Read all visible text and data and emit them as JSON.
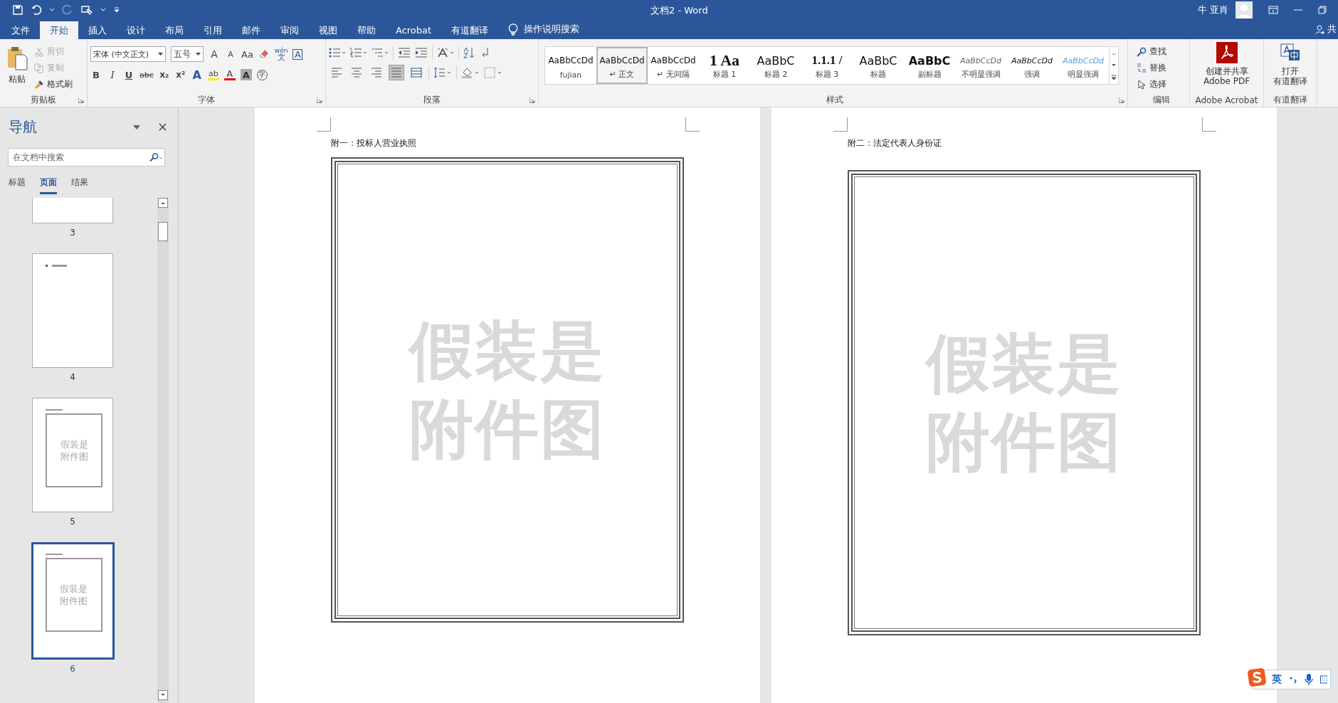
{
  "title_bar": {
    "title": "文档2 - Word",
    "user": "牛 亚肖"
  },
  "ribbon_tabs": [
    {
      "label": "文件",
      "selected": false
    },
    {
      "label": "开始",
      "selected": true
    },
    {
      "label": "插入",
      "selected": false
    },
    {
      "label": "设计",
      "selected": false
    },
    {
      "label": "布局",
      "selected": false
    },
    {
      "label": "引用",
      "selected": false
    },
    {
      "label": "邮件",
      "selected": false
    },
    {
      "label": "审阅",
      "selected": false
    },
    {
      "label": "视图",
      "selected": false
    },
    {
      "label": "帮助",
      "selected": false
    },
    {
      "label": "Acrobat",
      "selected": false
    },
    {
      "label": "有道翻译",
      "selected": false
    }
  ],
  "tell_me": "操作说明搜索",
  "share": "共",
  "clipboard": {
    "paste": "粘贴",
    "label": "剪贴板",
    "actions": [
      {
        "label": "剪切",
        "kind": "cut",
        "disabled": true
      },
      {
        "label": "复制",
        "kind": "copy",
        "disabled": true
      },
      {
        "label": "格式刷",
        "kind": "brush",
        "disabled": false
      }
    ]
  },
  "font": {
    "label": "字体",
    "font_name": "宋体 (中文正文)",
    "font_size": "五号",
    "row1": [
      {
        "glyph": "A",
        "kind": "grow"
      },
      {
        "glyph": "A",
        "kind": "shrink"
      },
      {
        "glyph": "Aa",
        "kind": "case"
      }
    ],
    "row2": [
      {
        "glyph": "B",
        "kind": "bold"
      },
      {
        "glyph": "I",
        "kind": "italic"
      },
      {
        "glyph": "U",
        "kind": "underline"
      },
      {
        "glyph": "abc",
        "kind": "strike"
      },
      {
        "glyph": "x₂",
        "kind": "sub"
      },
      {
        "glyph": "x²",
        "kind": "sup"
      }
    ],
    "phonetic": "wén",
    "phonetic_char": "文",
    "border_char": "A",
    "effects_char": "A",
    "highlight_char": "ab",
    "color_char": "A",
    "shade_char": "A",
    "enclose_char": "字"
  },
  "paragraph": {
    "label": "段落",
    "alignments": [
      {
        "kind": "left",
        "selected": false
      },
      {
        "kind": "center",
        "selected": false
      },
      {
        "kind": "right",
        "selected": false
      },
      {
        "kind": "justify",
        "selected": true
      },
      {
        "kind": "distributed",
        "selected": false
      }
    ]
  },
  "styles": {
    "label": "样式",
    "items": [
      {
        "preview": "AaBbCcDd",
        "name": "fujian",
        "kind": "plain",
        "selected": false
      },
      {
        "preview": "AaBbCcDd",
        "name": "↵ 正文",
        "kind": "plain",
        "selected": true
      },
      {
        "preview": "AaBbCcDd",
        "name": "↵ 无间隔",
        "kind": "plain",
        "selected": false
      },
      {
        "preview": "1 Aa",
        "name": "标题 1",
        "kind": "heading",
        "selected": false
      },
      {
        "preview": "AaBbC",
        "name": "标题 2",
        "kind": "large",
        "selected": false
      },
      {
        "preview": "1.1.1 /",
        "name": "标题 3",
        "kind": "serif",
        "selected": false
      },
      {
        "preview": "AaBbC",
        "name": "标题",
        "kind": "large",
        "selected": false
      },
      {
        "preview": "AaBbC",
        "name": "副标题",
        "kind": "strong",
        "selected": false
      },
      {
        "preview": "AaBbCcDd",
        "name": "不明显强调",
        "kind": "subtle",
        "selected": false
      },
      {
        "preview": "AaBbCcDd",
        "name": "强调",
        "kind": "emphasis",
        "selected": false
      },
      {
        "preview": "AaBbCcDd",
        "name": "明显强调",
        "kind": "intense",
        "selected": false
      }
    ]
  },
  "editing": {
    "label": "编辑",
    "actions": [
      {
        "label": "查找",
        "kind": "find"
      },
      {
        "label": "替换",
        "kind": "replace"
      },
      {
        "label": "选择",
        "kind": "select"
      }
    ]
  },
  "acrobat": {
    "button_lines": [
      "创建并共享",
      "Adobe PDF"
    ],
    "label": "Adobe Acrobat"
  },
  "youdao": {
    "button_lines": [
      "打开",
      "有道翻译"
    ],
    "label": "有道翻译"
  },
  "navigation": {
    "title": "导航",
    "search": {
      "placeholder": "在文档中搜索"
    },
    "tabs": [
      {
        "label": "标题",
        "selected": false
      },
      {
        "label": "页面",
        "selected": true
      },
      {
        "label": "结果",
        "selected": false
      }
    ],
    "thumbnails": [
      {
        "page": "3",
        "kind": "blank",
        "selected": false
      },
      {
        "page": "4",
        "kind": "text",
        "selected": false
      },
      {
        "page": "5",
        "kind": "attachment",
        "selected": false,
        "frame_lines": [
          "假装是",
          "附件图"
        ]
      },
      {
        "page": "6",
        "kind": "attachment",
        "selected": true,
        "frame_lines": [
          "假装是",
          "附件图"
        ]
      }
    ]
  },
  "pages": [
    {
      "heading": "附一：投标人营业执照",
      "frame_lines": [
        "假装是",
        "附件图"
      ]
    },
    {
      "heading": "附二：法定代表人身份证",
      "frame_lines": [
        "假装是",
        "附件图"
      ]
    }
  ],
  "ime": {
    "mode": "英"
  }
}
